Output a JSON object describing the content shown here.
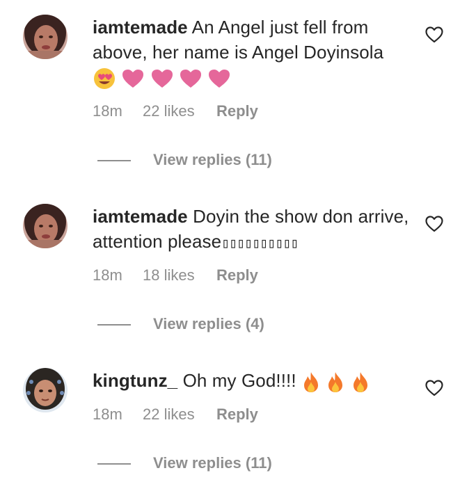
{
  "comments": [
    {
      "username": "iamtemade",
      "text": "An Angel just fell from above, her name is Angel Doyinsola",
      "emojis": [
        "smiling-face-with-heart-eyes",
        "pink-heart",
        "pink-heart",
        "pink-heart",
        "pink-heart"
      ],
      "time": "18m",
      "likes": "22 likes",
      "reply_label": "Reply",
      "view_replies": "View replies (11)"
    },
    {
      "username": "iamtemade",
      "text": "Doyin the show don arrive, attention please",
      "trailing_glyphs": "▯▯▯▯▯▯▯▯▯▯",
      "time": "18m",
      "likes": "18 likes",
      "reply_label": "Reply",
      "view_replies": "View replies (4)"
    },
    {
      "username": "kingtunz_",
      "text": "Oh my God!!!!",
      "emojis": [
        "fire",
        "fire",
        "fire"
      ],
      "time": "18m",
      "likes": "22 likes",
      "reply_label": "Reply",
      "view_replies": "View replies (11)"
    }
  ],
  "colors": {
    "text_primary": "#262626",
    "text_secondary": "#8e8e8e",
    "heart_emoji": "#e5679a",
    "fire_emoji": "#f4792b",
    "background": "#ffffff"
  },
  "icons": {
    "like": "heart-outline-icon"
  }
}
